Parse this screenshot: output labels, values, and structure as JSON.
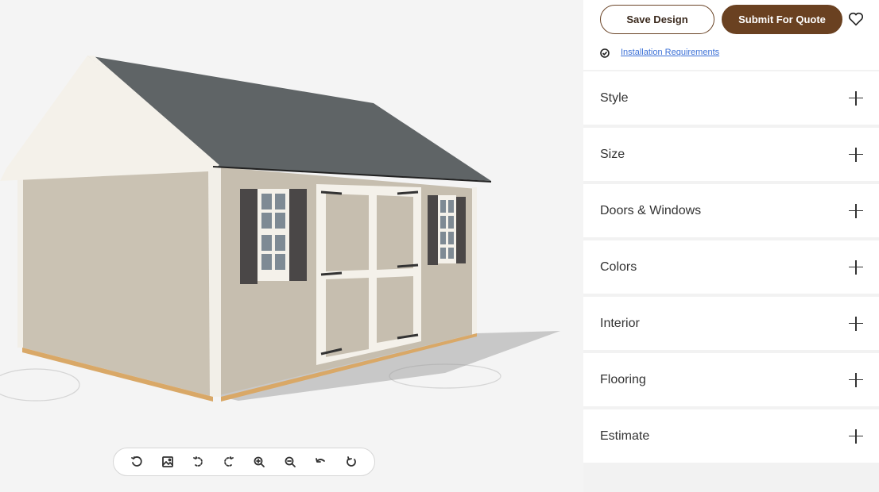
{
  "viewer": {
    "toolbar": [
      {
        "name": "reset-view-icon"
      },
      {
        "name": "image-icon"
      },
      {
        "name": "rotate-left-icon"
      },
      {
        "name": "rotate-right-icon"
      },
      {
        "name": "zoom-in-icon"
      },
      {
        "name": "zoom-out-icon"
      },
      {
        "name": "undo-icon"
      },
      {
        "name": "refresh-icon"
      }
    ]
  },
  "actions": {
    "save_label": "Save Design",
    "quote_label": "Submit For Quote",
    "requirements_label": "Installation Requirements"
  },
  "sections": [
    {
      "label": "Style"
    },
    {
      "label": "Size"
    },
    {
      "label": "Doors & Windows"
    },
    {
      "label": "Colors"
    },
    {
      "label": "Interior"
    },
    {
      "label": "Flooring"
    },
    {
      "label": "Estimate"
    }
  ],
  "colors": {
    "accent": "#6a4121",
    "link": "#3a6fd6",
    "siding": "#c9c1b3",
    "trim": "#f4f1ea",
    "roof": "#5f6466",
    "shutter": "#4a4747"
  }
}
